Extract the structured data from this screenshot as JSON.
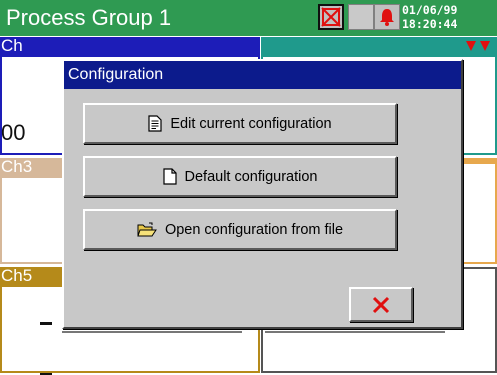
{
  "header": {
    "title": "Process Group 1",
    "date": "01/06/99",
    "time": "18:20:44",
    "indicators": [
      "alarm-disabled-icon",
      "blank-indicator",
      "alarm-bell-icon"
    ]
  },
  "channels": [
    {
      "label": "Ch",
      "value": "00"
    },
    {
      "label": "Ch3",
      "value": "—"
    },
    {
      "label": "Ch5",
      "value": "—"
    }
  ],
  "dialog": {
    "title": "Configuration",
    "buttons": [
      {
        "label": "Edit current configuration",
        "icon": "edit-document-icon"
      },
      {
        "label": "Default configuration",
        "icon": "blank-document-icon"
      },
      {
        "label": "Open configuration from file",
        "icon": "open-folder-icon"
      }
    ],
    "close_icon": "close-x-icon"
  },
  "colors": {
    "title_bar": "#2f9a52",
    "dialog_title": "#0c1b8c",
    "ch1_header": "#1d1db8",
    "ch2_header": "#1f9a8c",
    "ch3_header": "#d6b89a",
    "ch5_header": "#b58a1a",
    "close_x": "#e01010",
    "alarm_red": "#e01010"
  }
}
